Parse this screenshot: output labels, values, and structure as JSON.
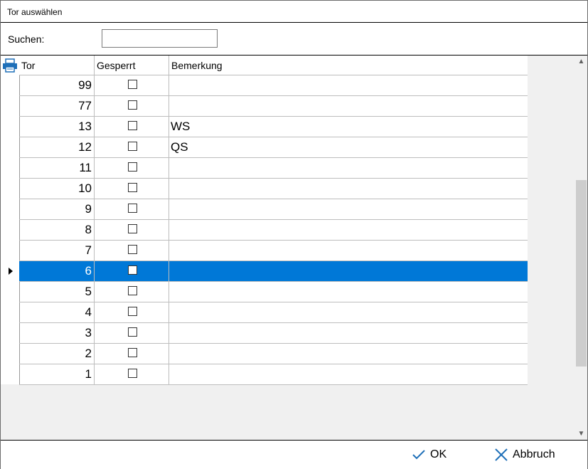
{
  "window": {
    "title": "Tor auswählen"
  },
  "search": {
    "label": "Suchen:",
    "value": ""
  },
  "columns": {
    "tor": "Tor",
    "gesperrt": "Gesperrt",
    "bemerkung": "Bemerkung"
  },
  "rows": [
    {
      "tor": "99",
      "gesperrt": false,
      "bemerkung": ""
    },
    {
      "tor": "77",
      "gesperrt": false,
      "bemerkung": ""
    },
    {
      "tor": "13",
      "gesperrt": false,
      "bemerkung": "WS"
    },
    {
      "tor": "12",
      "gesperrt": false,
      "bemerkung": "QS"
    },
    {
      "tor": "11",
      "gesperrt": false,
      "bemerkung": ""
    },
    {
      "tor": "10",
      "gesperrt": false,
      "bemerkung": ""
    },
    {
      "tor": "9",
      "gesperrt": false,
      "bemerkung": ""
    },
    {
      "tor": "8",
      "gesperrt": false,
      "bemerkung": ""
    },
    {
      "tor": "7",
      "gesperrt": false,
      "bemerkung": ""
    },
    {
      "tor": "6",
      "gesperrt": false,
      "bemerkung": "",
      "selected": true
    },
    {
      "tor": "5",
      "gesperrt": false,
      "bemerkung": ""
    },
    {
      "tor": "4",
      "gesperrt": false,
      "bemerkung": ""
    },
    {
      "tor": "3",
      "gesperrt": false,
      "bemerkung": ""
    },
    {
      "tor": "2",
      "gesperrt": false,
      "bemerkung": ""
    },
    {
      "tor": "1",
      "gesperrt": false,
      "bemerkung": ""
    }
  ],
  "buttons": {
    "ok": "OK",
    "cancel": "Abbruch"
  },
  "colors": {
    "selection": "#0078d7",
    "icon_blue": "#1e6fb8"
  },
  "icons": {
    "print": "printer-icon",
    "ok": "checkmark-icon",
    "cancel": "close-icon",
    "row_indicator": "row-pointer-icon"
  }
}
